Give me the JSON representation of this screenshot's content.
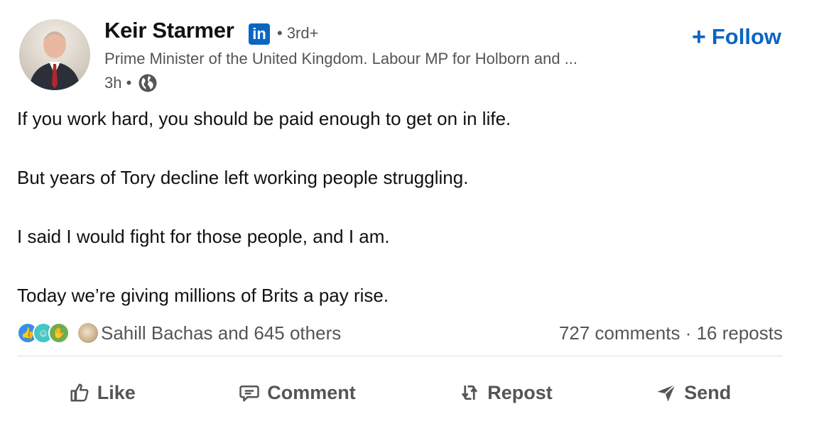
{
  "author": {
    "name": "Keir Starmer",
    "badge": "in",
    "degree": "• 3rd+",
    "headline": "Prime Minister of the United Kingdom. Labour MP for Holborn and ...",
    "time": "3h •",
    "avatar_icon": "avatar-photo"
  },
  "follow": {
    "plus": "+",
    "label": "Follow",
    "color": "#0a66c2"
  },
  "post": {
    "paragraphs": [
      "If you work hard, you should be paid enough to get on in life.",
      "But years of Tory decline left working people struggling.",
      "I said I would fight for those people, and I am.",
      "Today we’re giving millions of Brits a pay rise."
    ]
  },
  "social": {
    "reaction_icons": [
      "like-icon",
      "funny-icon",
      "celebrate-icon"
    ],
    "reactors_text": "Sahill Bachas and 645 others",
    "comments_reposts": "727 comments · 16 reposts"
  },
  "actions": {
    "like": "Like",
    "comment": "Comment",
    "repost": "Repost",
    "send": "Send"
  }
}
